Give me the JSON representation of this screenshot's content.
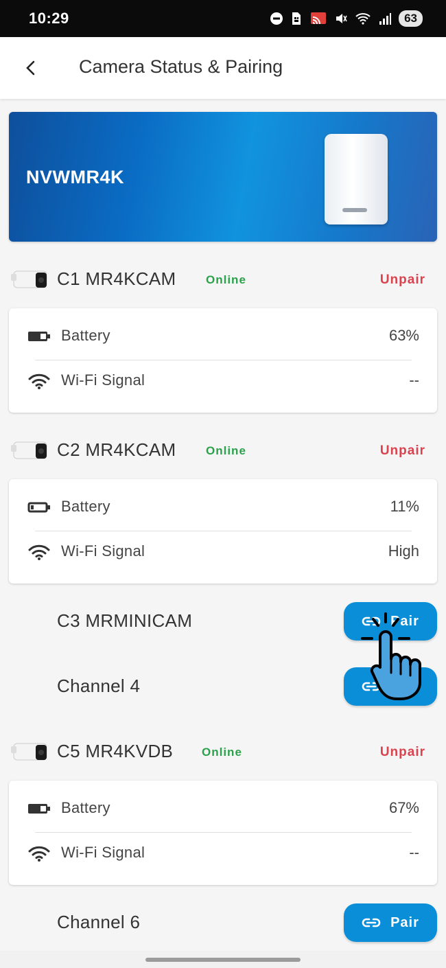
{
  "status_bar": {
    "time": "10:29",
    "battery": "63"
  },
  "app_bar": {
    "title": "Camera Status & Pairing"
  },
  "hub": {
    "name": "NVWMR4K"
  },
  "labels": {
    "battery": "Battery",
    "wifi": "Wi-Fi Signal",
    "unpair": "Unpair",
    "pair": "Pair",
    "online": "Online"
  },
  "cameras": [
    {
      "name": "C1 MR4KCAM",
      "status": "Online",
      "battery": "63%",
      "wifi": "--"
    },
    {
      "name": "C2 MR4KCAM",
      "status": "Online",
      "battery": "11%",
      "wifi": "High"
    },
    {
      "name": "C3 MRMINICAM"
    },
    {
      "name": "Channel 4"
    },
    {
      "name": "C5 MR4KVDB",
      "status": "Online",
      "battery": "67%",
      "wifi": "--"
    },
    {
      "name": "Channel 6"
    }
  ],
  "colors": {
    "online": "#2aa14a",
    "unpair": "#d9434f",
    "pair_button": "#0a8ed8",
    "hero_start": "#0e4f9c",
    "hero_end": "#2a63b6"
  },
  "icons": [
    "back-arrow-icon",
    "battery-icon",
    "wifi-icon",
    "link-icon",
    "camera-thumbnail",
    "hand-pointer-icon"
  ]
}
